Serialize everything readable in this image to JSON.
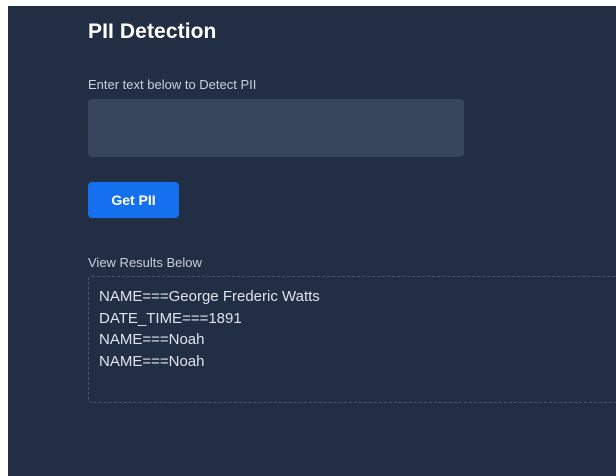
{
  "header": {
    "title": "PII Detection"
  },
  "form": {
    "input_label": "Enter text below to Detect PII",
    "input_value": "",
    "submit_label": "Get PII"
  },
  "results": {
    "label": "View Results Below",
    "lines": [
      "NAME===George Frederic Watts",
      "DATE_TIME===1891",
      "NAME===Noah",
      "NAME===Noah"
    ]
  },
  "colors": {
    "background": "#222e44",
    "input_background": "#37465c",
    "button_primary": "#1570ef",
    "text": "#ffffff"
  }
}
